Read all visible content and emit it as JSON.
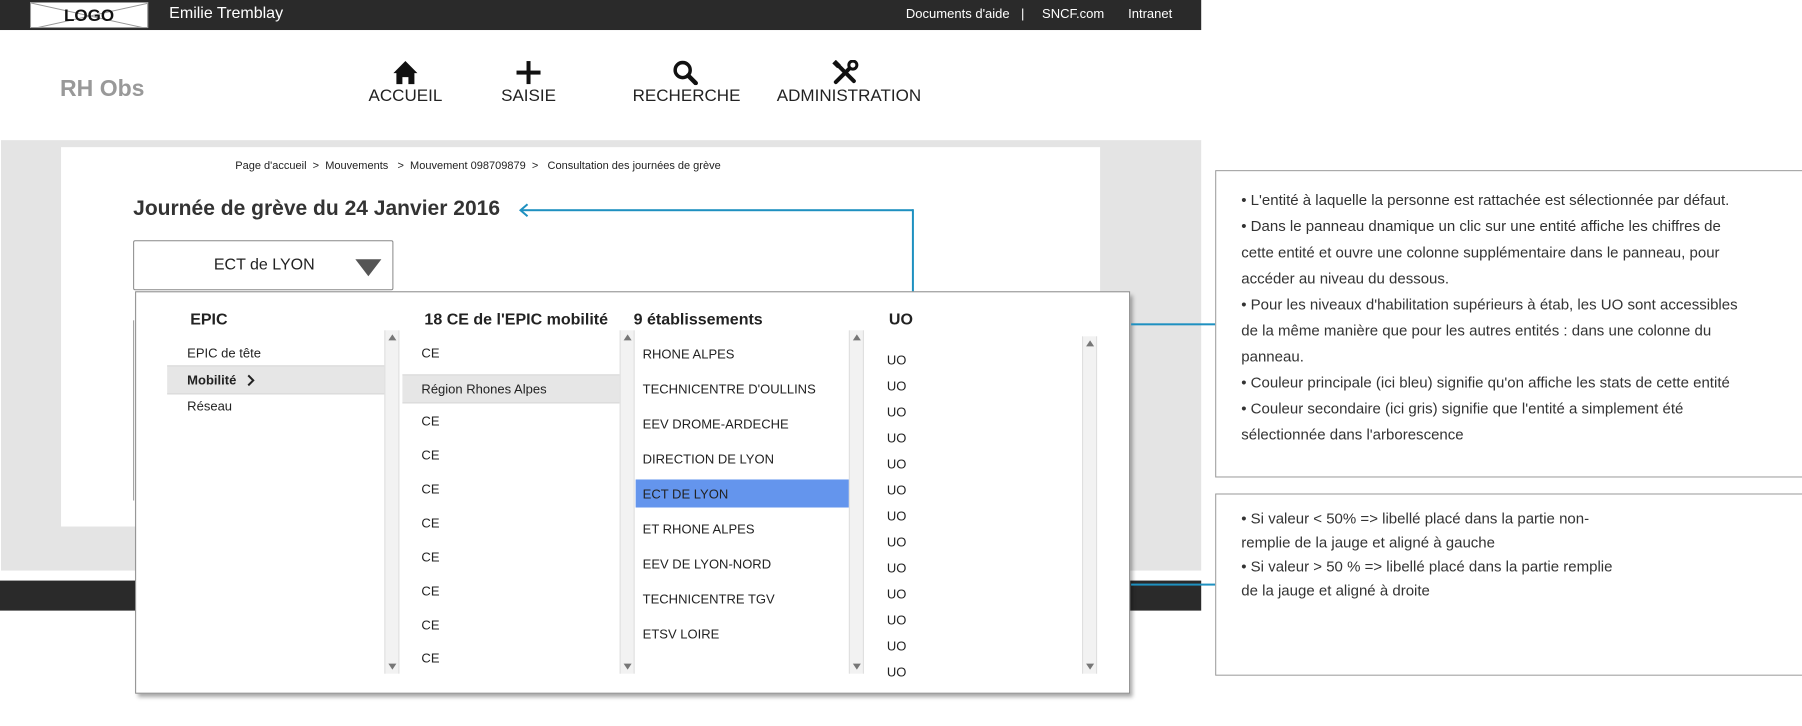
{
  "topbar": {
    "logo": "LOGO",
    "user_name": "Emilie Tremblay",
    "links": [
      "Documents d'aide",
      "|",
      "SNCF.com",
      "Intranet"
    ]
  },
  "header": {
    "app_name": "RH Obs",
    "nav": [
      {
        "label": "ACCUEIL",
        "icon": "home-icon"
      },
      {
        "label": "SAISIE",
        "icon": "plus-icon"
      },
      {
        "label": "RECHERCHE",
        "icon": "search-icon"
      },
      {
        "label": "ADMINISTRATION",
        "icon": "tools-icon"
      }
    ]
  },
  "breadcrumb": [
    "Page d'accueil",
    ">",
    "Mouvements",
    ">",
    "Mouvement 098709879",
    ">",
    "Consultation des journées de grève"
  ],
  "page": {
    "title": "Journée de grève du 24 Janvier 2016",
    "selected_entity": "ECT de LYON"
  },
  "dropdown": {
    "columns": [
      {
        "header": "EPIC",
        "items": [
          "EPIC de tête",
          "Mobilité",
          "Réseau"
        ],
        "selected": "Mobilité"
      },
      {
        "header": "18 CE  de l'EPIC mobilité",
        "items": [
          "CE",
          "Région Rhones Alpes",
          "CE",
          "CE",
          "CE",
          "CE",
          "CE",
          "CE",
          "CE",
          "CE"
        ],
        "selected": "Région Rhones Alpes"
      },
      {
        "header": "9 établissements",
        "items": [
          "RHONE ALPES",
          "TECHNICENTRE D'OULLINS",
          "EEV DROME-ARDECHE",
          "DIRECTION DE LYON",
          "ECT DE LYON",
          "ET RHONE ALPES",
          "EEV DE LYON-NORD",
          "TECHNICENTRE TGV",
          "ETSV LOIRE"
        ],
        "selected": "ECT DE LYON"
      },
      {
        "header": "UO",
        "items": [
          "UO",
          "UO",
          "UO",
          "UO",
          "UO",
          "UO",
          "UO",
          "UO",
          "UO",
          "UO",
          "UO",
          "UO",
          "UO"
        ]
      }
    ]
  },
  "annotations": {
    "note1": [
      "• L'entité à laquelle la personne est rattachée est sélectionnée par défaut.",
      "• Dans le panneau dnamique un clic sur une entité affiche les chiffres de",
      "cette entité et ouvre une colonne supplémentaire dans le panneau, pour",
      "accéder au niveau du dessous.",
      "• Pour les niveaux d'habilitation supérieurs à étab, les UO sont accessibles",
      "de la même manière que pour les autres entités : dans une colonne du",
      "panneau.",
      "• Couleur principale (ici bleu) signifie qu'on affiche les stats de cette entité",
      "• Couleur secondaire (ici gris) signifie que l'entité a simplement été",
      "sélectionnée dans l'arborescence"
    ],
    "note2": [
      "• Si valeur < 50% => libellé placé dans la partie non-",
      "remplie de la jauge et aligné à gauche",
      "• Si valeur > 50 % => libellé placé dans la partie remplie",
      "de la jauge et aligné à droite"
    ]
  },
  "colors": {
    "topbar": "#2a2a2a",
    "primary_selection": "#6495ed",
    "secondary_selection": "#e6e6e6",
    "connector": "#1e90c0"
  }
}
